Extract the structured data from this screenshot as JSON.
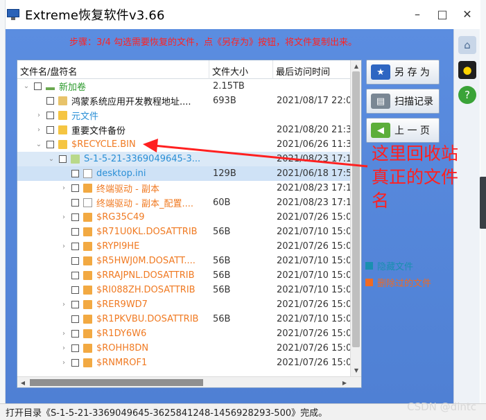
{
  "window": {
    "title": "Extreme恢复软件v3.66",
    "minimize": "–",
    "maximize": "□",
    "close": "✕"
  },
  "step_text": "步骤：3/4 勾选需要恢复的文件，点《另存为》按钮，将文件复制出来。",
  "columns": [
    "文件名/盘符名",
    "文件大小",
    "最后访问时间"
  ],
  "rows": [
    {
      "twisty": "⌄",
      "indent": 0,
      "icon": "disk",
      "name": "新加卷",
      "color": "green",
      "size": "2.15TB",
      "time": ""
    },
    {
      "twisty": "",
      "indent": 1,
      "icon": "app",
      "name": "鸿蒙系统应用开发教程地址....",
      "color": "black",
      "size": "693B",
      "time": "2021/08/17 22:0"
    },
    {
      "twisty": "›",
      "indent": 1,
      "icon": "folder",
      "name": "元文件",
      "color": "blue",
      "size": "",
      "time": ""
    },
    {
      "twisty": "›",
      "indent": 1,
      "icon": "folder",
      "name": "重要文件备份",
      "color": "black",
      "size": "",
      "time": "2021/08/20 21:3"
    },
    {
      "twisty": "⌄",
      "indent": 1,
      "icon": "folder",
      "name": "$RECYCLE.BIN",
      "color": "orange",
      "size": "",
      "time": "2021/06/26 11:3"
    },
    {
      "twisty": "⌄",
      "indent": 2,
      "icon": "folder-green",
      "name": "S-1-5-21-3369049645-3...",
      "color": "blue",
      "size": "",
      "time": "2021/08/23 17:1",
      "selected": true
    },
    {
      "twisty": "",
      "indent": 3,
      "icon": "doc",
      "name": "desktop.ini",
      "color": "blue",
      "size": "129B",
      "time": "2021/06/18 17:5",
      "highlight": true
    },
    {
      "twisty": "›",
      "indent": 3,
      "icon": "folder-orange",
      "name": "终端驱动 - 副本",
      "color": "orange",
      "size": "",
      "time": "2021/08/23 17:1"
    },
    {
      "twisty": "",
      "indent": 3,
      "icon": "doc",
      "name": "终端驱动 - 副本_配置....",
      "color": "orange",
      "size": "60B",
      "time": "2021/08/23 17:1"
    },
    {
      "twisty": "›",
      "indent": 3,
      "icon": "folder-orange",
      "name": "$RG35C49",
      "color": "orange",
      "size": "",
      "time": "2021/07/26 15:0"
    },
    {
      "twisty": "",
      "indent": 3,
      "icon": "folder-orange",
      "name": "$R71U0KL.DOSATTRIB",
      "color": "orange",
      "size": "56B",
      "time": "2021/07/10 15:0"
    },
    {
      "twisty": "›",
      "indent": 3,
      "icon": "folder-orange",
      "name": "$RYPI9HE",
      "color": "orange",
      "size": "",
      "time": "2021/07/26 15:0"
    },
    {
      "twisty": "",
      "indent": 3,
      "icon": "folder-orange",
      "name": "$R5HWJ0M.DOSATT....",
      "color": "orange",
      "size": "56B",
      "time": "2021/07/10 15:0"
    },
    {
      "twisty": "",
      "indent": 3,
      "icon": "folder-orange",
      "name": "$RRAJPNL.DOSATTRIB",
      "color": "orange",
      "size": "56B",
      "time": "2021/07/10 15:0"
    },
    {
      "twisty": "",
      "indent": 3,
      "icon": "folder-orange",
      "name": "$RI088ZH.DOSATTRIB",
      "color": "orange",
      "size": "56B",
      "time": "2021/07/10 15:0"
    },
    {
      "twisty": "›",
      "indent": 3,
      "icon": "folder-orange",
      "name": "$RER9WD7",
      "color": "orange",
      "size": "",
      "time": "2021/07/26 15:0"
    },
    {
      "twisty": "",
      "indent": 3,
      "icon": "folder-orange",
      "name": "$R1PKVBU.DOSATTRIB",
      "color": "orange",
      "size": "56B",
      "time": "2021/07/10 15:0"
    },
    {
      "twisty": "›",
      "indent": 3,
      "icon": "folder-orange",
      "name": "$R1DY6W6",
      "color": "orange",
      "size": "",
      "time": "2021/07/26 15:0"
    },
    {
      "twisty": "›",
      "indent": 3,
      "icon": "folder-orange",
      "name": "$ROHH8DN",
      "color": "orange",
      "size": "",
      "time": "2021/07/26 15:0"
    },
    {
      "twisty": "›",
      "indent": 3,
      "icon": "folder-orange",
      "name": "$RNMROF1",
      "color": "orange",
      "size": "",
      "time": "2021/07/26 15:0"
    }
  ],
  "buttons": {
    "save_as": "另 存 为",
    "scan_log": "扫描记录",
    "prev_page": "上 一 页"
  },
  "legend": {
    "hidden_files": "隐藏文件",
    "deleted_files": "删除过的文件",
    "hidden_color": "#1a8fb0",
    "deleted_color": "#f06a22"
  },
  "annotation": {
    "line1": "这里回收站",
    "line2": "真正的文件",
    "line3": "名"
  },
  "status_text": "打开目录《S-1-5-21-3369049645-3625841248-1456928293-500》完成。",
  "watermark": "CSDN @dintc",
  "colors": {
    "accent_blue": "#4f80d4",
    "annotation_red": "#ff2020"
  },
  "side_icons": [
    "network-icon",
    "qq-penguin-icon",
    "help-icon"
  ]
}
